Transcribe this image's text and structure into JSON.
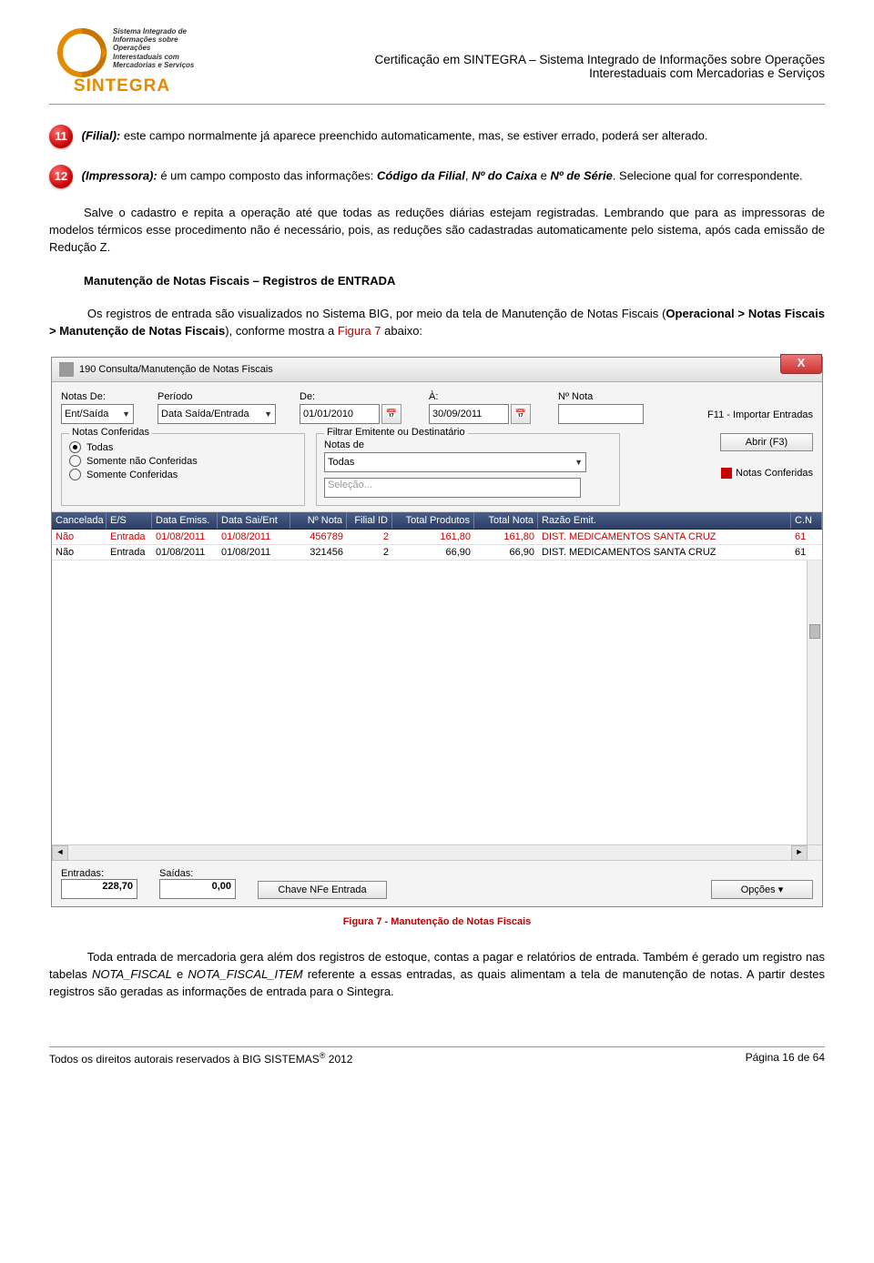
{
  "header": {
    "logo_name": "SINTEGRA",
    "logo_sub": "Sistema Integrado de Informações sobre Operações Interestaduais com Mercadorias e Serviços",
    "title_line1": "Certificação em SINTEGRA – Sistema Integrado de Informações sobre Operações",
    "title_line2": "Interestaduais com Mercadorias e Serviços"
  },
  "badges": {
    "b11": "11",
    "b12": "12"
  },
  "text": {
    "filial_label": "(Filial):",
    "filial_rest": " este campo normalmente já aparece preenchido automaticamente, mas, se estiver errado, poderá ser alterado.",
    "imp_label": "(Impressora):",
    "imp_rest_a": " é um campo composto das informações: ",
    "imp_i1": "Código da Filial",
    "imp_sep1": ", ",
    "imp_i2": "Nº do Caixa",
    "imp_sep2": " e ",
    "imp_i3": "Nº de Série",
    "imp_rest_b": ". Selecione qual for correspondente.",
    "p_salve": "Salve o cadastro e repita a operação até que todas as reduções diárias estejam registradas. Lembrando que para as impressoras de modelos térmicos esse procedimento não é necessário, pois, as reduções são cadastradas automaticamente pelo sistema, após cada emissão de Redução Z.",
    "h_manut": "Manutenção de Notas Fiscais – Registros de ENTRADA",
    "p_reg_a": "Os registros de entrada são visualizados no Sistema BIG, por meio da tela de Manutenção de Notas Fiscais (",
    "p_reg_b": "Operacional > Notas Fiscais > Manutenção de Notas Fiscais",
    "p_reg_c": "), conforme mostra a ",
    "p_reg_fig": "Figura 7",
    "p_reg_d": " abaixo:",
    "fig_caption": "Figura 7 - Manutenção de Notas Fiscais",
    "p_fim_a": "Toda entrada de mercadoria gera além dos registros de estoque, contas a pagar e relatórios de entrada. Também é gerado um registro nas tabelas ",
    "p_fim_i1": "NOTA_FISCAL",
    "p_fim_mid": " e ",
    "p_fim_i2": "NOTA_FISCAL_ITEM",
    "p_fim_b": " referente a essas entradas, as quais alimentam a tela de manutenção de notas. A partir destes registros são geradas as informações de entrada para o Sintegra."
  },
  "window": {
    "title": "190 Consulta/Manutenção de Notas Fiscais",
    "close": "X",
    "labels": {
      "notas_de": "Notas De:",
      "periodo": "Período",
      "de": "De:",
      "a": "À:",
      "n_nota": "Nº Nota",
      "f11": "F11 - Importar Entradas",
      "notas_conf": "Notas Conferidas",
      "r_todas": "Todas",
      "r_nao": "Somente não Conferidas",
      "r_conf": "Somente Conferidas",
      "filtrar": "Filtrar Emitente ou Destinatário",
      "notas_de2": "Notas de",
      "selecao": "Seleção...",
      "abrir": "Abrir (F3)",
      "legend": "Notas Conferidas",
      "entradas": "Entradas:",
      "saidas": "Saídas:",
      "chave": "Chave NFe Entrada",
      "opcoes": "Opções ▾"
    },
    "values": {
      "notas_de": "Ent/Saída",
      "periodo": "Data Saída/Entrada",
      "de": "01/01/2010",
      "a": "30/09/2011",
      "n_nota": "",
      "filtro": "Todas",
      "entradas": "228,70",
      "saidas": "0,00"
    },
    "columns": [
      "Cancelada",
      "E/S",
      "Data Emiss.",
      "Data Sai/Ent",
      "Nº Nota",
      "Filial ID",
      "Total Produtos",
      "Total Nota",
      "Razão Emit.",
      "C.N"
    ],
    "rows": [
      {
        "cancelada": "Não",
        "es": "Entrada",
        "de": "01/08/2011",
        "dse": "01/08/2011",
        "nn": "456789",
        "fid": "2",
        "tp": "161,80",
        "tn": "161,80",
        "re": "DIST. MEDICAMENTOS SANTA CRUZ",
        "cnpj": "61",
        "red": true
      },
      {
        "cancelada": "Não",
        "es": "Entrada",
        "de": "01/08/2011",
        "dse": "01/08/2011",
        "nn": "321456",
        "fid": "2",
        "tp": "66,90",
        "tn": "66,90",
        "re": "DIST. MEDICAMENTOS SANTA CRUZ",
        "cnpj": "61",
        "red": false
      }
    ]
  },
  "footer": {
    "left_a": "Todos os direitos autorais reservados à BIG SISTEMAS",
    "left_sup": "®",
    "left_b": " 2012",
    "right": "Página  16 de 64"
  }
}
